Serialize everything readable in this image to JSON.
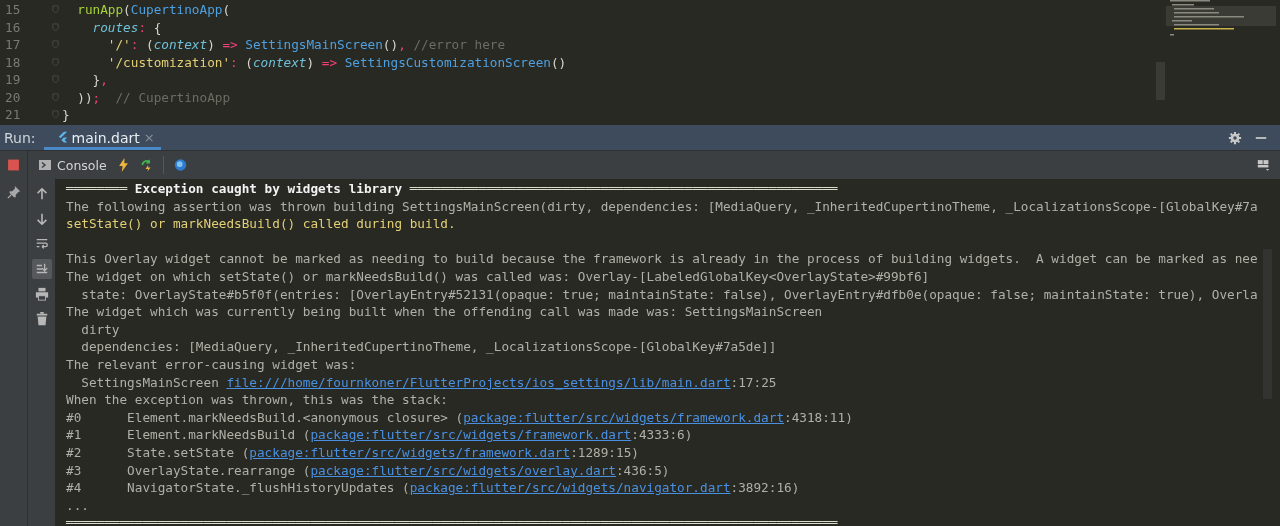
{
  "editor": {
    "lines": [
      {
        "number": "15",
        "tokens": [
          {
            "text": "  runApp",
            "kind": "fn"
          },
          {
            "text": "(",
            "kind": "punct"
          },
          {
            "text": "CupertinoApp",
            "kind": "class"
          },
          {
            "text": "(",
            "kind": "punct"
          }
        ]
      },
      {
        "number": "16",
        "tokens": [
          {
            "text": "    routes",
            "kind": "param"
          },
          {
            "text": ":",
            "kind": "op"
          },
          {
            "text": " {",
            "kind": "punct"
          }
        ]
      },
      {
        "number": "17",
        "tokens": [
          {
            "text": "      '/'",
            "kind": "str"
          },
          {
            "text": ":",
            "kind": "op"
          },
          {
            "text": " (",
            "kind": "punct"
          },
          {
            "text": "context",
            "kind": "param"
          },
          {
            "text": ") ",
            "kind": "punct"
          },
          {
            "text": "=>",
            "kind": "op"
          },
          {
            "text": " SettingsMainScreen",
            "kind": "class"
          },
          {
            "text": "()",
            "kind": "punct"
          },
          {
            "text": ",",
            "kind": "op"
          },
          {
            "text": " //error here",
            "kind": "comment"
          }
        ]
      },
      {
        "number": "18",
        "tokens": [
          {
            "text": "      '/customization'",
            "kind": "str"
          },
          {
            "text": ":",
            "kind": "op"
          },
          {
            "text": " (",
            "kind": "punct"
          },
          {
            "text": "context",
            "kind": "param"
          },
          {
            "text": ") ",
            "kind": "punct"
          },
          {
            "text": "=>",
            "kind": "op"
          },
          {
            "text": " SettingsCustomizationScreen",
            "kind": "class"
          },
          {
            "text": "()",
            "kind": "punct"
          }
        ]
      },
      {
        "number": "19",
        "tokens": [
          {
            "text": "    }",
            "kind": "punct"
          },
          {
            "text": ",",
            "kind": "op"
          }
        ]
      },
      {
        "number": "20",
        "tokens": [
          {
            "text": "  ))",
            "kind": "punct"
          },
          {
            "text": ";",
            "kind": "op"
          },
          {
            "text": "  // CupertinoApp",
            "kind": "comment"
          }
        ]
      },
      {
        "number": "21",
        "tokens": [
          {
            "text": "}",
            "kind": "punct"
          }
        ]
      }
    ]
  },
  "run_bar": {
    "label": "Run:",
    "tabs": [
      {
        "label": "main.dart",
        "close": "×",
        "selected": true
      }
    ]
  },
  "toolbar": {
    "console_label": "Console"
  },
  "side_tools": [
    {
      "kind": "up",
      "on": false
    },
    {
      "kind": "down",
      "on": false
    },
    {
      "kind": "wrap",
      "on": false
    },
    {
      "kind": "scroll-end",
      "on": true
    },
    {
      "kind": "print",
      "on": false
    },
    {
      "kind": "trash",
      "on": false
    }
  ],
  "console": {
    "lines": [
      {
        "kind": "heading",
        "spaced": false,
        "segments": [
          {
            "text": "════════",
            "kind": "rule"
          },
          {
            "text": " Exception caught by widgets library ",
            "kind": "title"
          },
          {
            "text": "════════════════════════════════════════════════════════",
            "kind": "rule"
          }
        ]
      },
      {
        "kind": "plain",
        "spaced": false,
        "segments": [
          {
            "text": "The following assertion was thrown building SettingsMainScreen(dirty, dependencies: [MediaQuery, _InheritedCupertinoTheme, _LocalizationsScope-[GlobalKey#7a",
            "kind": "text"
          }
        ]
      },
      {
        "kind": "warning",
        "spaced": false,
        "segments": [
          {
            "text": "setState() or markNeedsBuild() called during build.",
            "kind": "text"
          }
        ]
      },
      {
        "kind": "plain",
        "spaced": true,
        "segments": [
          {
            "text": "This Overlay widget cannot be marked as needing to build because the framework is already in the process of building widgets.  A widget can be marked as nee",
            "kind": "text"
          }
        ]
      },
      {
        "kind": "plain",
        "spaced": false,
        "segments": [
          {
            "text": "The widget on which setState() or markNeedsBuild() was called was: Overlay-[LabeledGlobalKey<OverlayState>#99bf6]",
            "kind": "text"
          }
        ]
      },
      {
        "kind": "plain",
        "spaced": false,
        "segments": [
          {
            "text": "  state: OverlayState#b5f0f(entries: [OverlayEntry#52131(opaque: true; maintainState: false), OverlayEntry#dfb0e(opaque: false; maintainState: true), Overla",
            "kind": "text"
          }
        ]
      },
      {
        "kind": "plain",
        "spaced": false,
        "segments": [
          {
            "text": "The widget which was currently being built when the offending call was made was: SettingsMainScreen",
            "kind": "text"
          }
        ]
      },
      {
        "kind": "plain",
        "spaced": false,
        "segments": [
          {
            "text": "  dirty",
            "kind": "text"
          }
        ]
      },
      {
        "kind": "plain",
        "spaced": false,
        "segments": [
          {
            "text": "  dependencies: [MediaQuery, _InheritedCupertinoTheme, _LocalizationsScope-[GlobalKey#7a5de]]",
            "kind": "text"
          }
        ]
      },
      {
        "kind": "plain",
        "spaced": false,
        "segments": [
          {
            "text": "The relevant error-causing widget was:",
            "kind": "text"
          }
        ]
      },
      {
        "kind": "plain",
        "spaced": false,
        "segments": [
          {
            "text": "  SettingsMainScreen ",
            "kind": "text"
          },
          {
            "text": "file:///home/fournkoner/FlutterProjects/ios_settings/lib/main.dart",
            "kind": "link"
          },
          {
            "text": ":17:25",
            "kind": "text"
          }
        ]
      },
      {
        "kind": "plain",
        "spaced": false,
        "segments": [
          {
            "text": "When the exception was thrown, this was the stack:",
            "kind": "text"
          }
        ]
      },
      {
        "kind": "plain",
        "spaced": false,
        "segments": [
          {
            "text": "#0      Element.markNeedsBuild.<anonymous closure> (",
            "kind": "text"
          },
          {
            "text": "package:flutter/src/widgets/framework.dart",
            "kind": "link"
          },
          {
            "text": ":4318:11)",
            "kind": "text"
          }
        ]
      },
      {
        "kind": "plain",
        "spaced": false,
        "segments": [
          {
            "text": "#1      Element.markNeedsBuild (",
            "kind": "text"
          },
          {
            "text": "package:flutter/src/widgets/framework.dart",
            "kind": "link"
          },
          {
            "text": ":4333:6)",
            "kind": "text"
          }
        ]
      },
      {
        "kind": "plain",
        "spaced": false,
        "segments": [
          {
            "text": "#2      State.setState (",
            "kind": "text"
          },
          {
            "text": "package:flutter/src/widgets/framework.dart",
            "kind": "link"
          },
          {
            "text": ":1289:15)",
            "kind": "text"
          }
        ]
      },
      {
        "kind": "plain",
        "spaced": false,
        "segments": [
          {
            "text": "#3      OverlayState.rearrange (",
            "kind": "text"
          },
          {
            "text": "package:flutter/src/widgets/overlay.dart",
            "kind": "link"
          },
          {
            "text": ":436:5)",
            "kind": "text"
          }
        ]
      },
      {
        "kind": "plain",
        "spaced": false,
        "segments": [
          {
            "text": "#4      NavigatorState._flushHistoryUpdates (",
            "kind": "text"
          },
          {
            "text": "package:flutter/src/widgets/navigator.dart",
            "kind": "link"
          },
          {
            "text": ":3892:16)",
            "kind": "text"
          }
        ]
      },
      {
        "kind": "plain",
        "spaced": false,
        "segments": [
          {
            "text": "...",
            "kind": "text"
          }
        ]
      },
      {
        "kind": "heading",
        "spaced": false,
        "segments": [
          {
            "text": "═════════════════════════════════════════════════════════════════════════════════════════════════════",
            "kind": "rule"
          }
        ]
      }
    ]
  }
}
